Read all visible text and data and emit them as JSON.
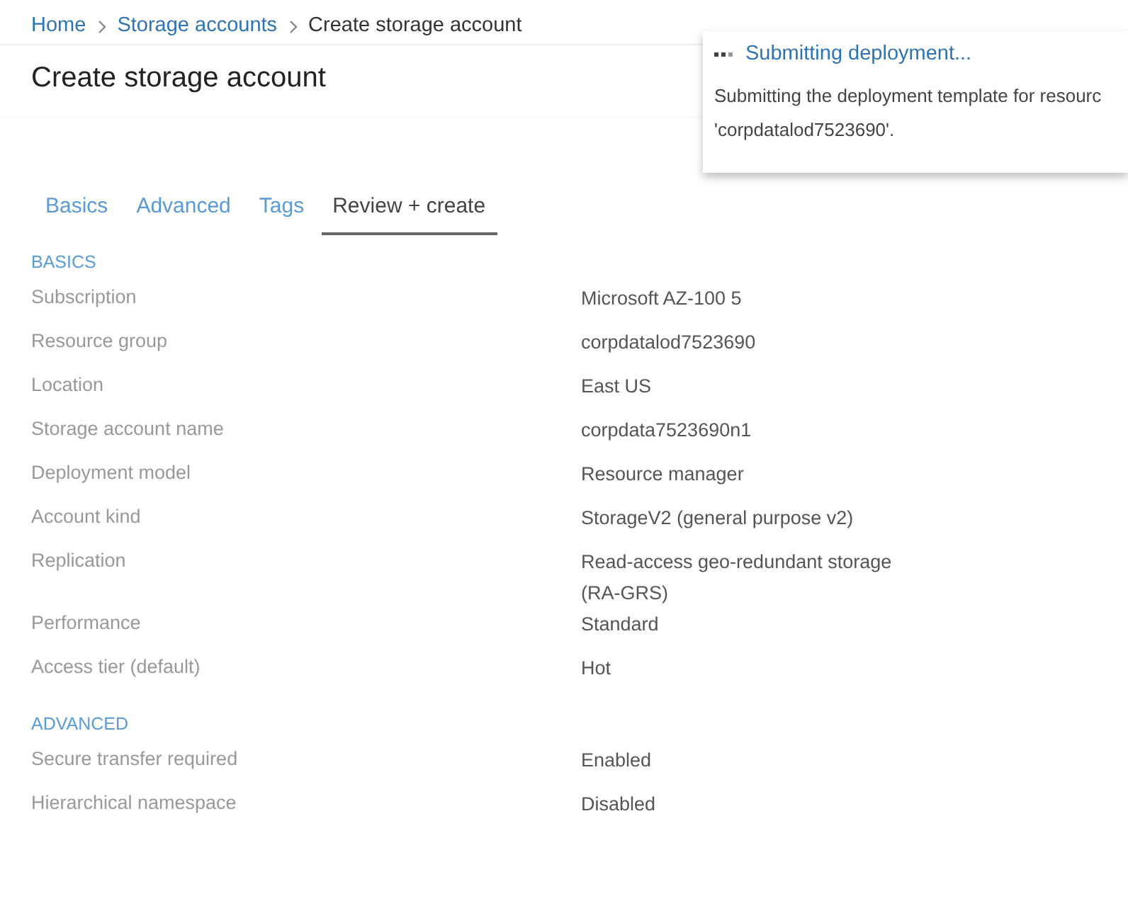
{
  "breadcrumb": [
    {
      "label": "Home",
      "kind": "link"
    },
    {
      "label": "Storage accounts",
      "kind": "link"
    },
    {
      "label": "Create storage account",
      "kind": "current"
    }
  ],
  "title": "Create storage account",
  "notification": {
    "title": "Submitting deployment...",
    "message": "Submitting the deployment template for resourc",
    "detail": "'corpdatalod7523690'."
  },
  "tabs": [
    {
      "label": "Basics",
      "selected": false
    },
    {
      "label": "Advanced",
      "selected": false
    },
    {
      "label": "Tags",
      "selected": false
    },
    {
      "label": "Review + create",
      "selected": true
    }
  ],
  "sections": [
    {
      "heading": "BASICS",
      "rows": [
        {
          "label": "Subscription",
          "value": "Microsoft AZ-100 5"
        },
        {
          "label": "Resource group",
          "value": "corpdatalod7523690"
        },
        {
          "label": "Location",
          "value": "East US"
        },
        {
          "label": "Storage account name",
          "value": "corpdata7523690n1"
        },
        {
          "label": "Deployment model",
          "value": "Resource manager"
        },
        {
          "label": "Account kind",
          "value": "StorageV2 (general purpose v2)"
        },
        {
          "label": "Replication",
          "value": "Read-access geo-redundant storage (RA-GRS)"
        },
        {
          "label": "Performance",
          "value": "Standard"
        },
        {
          "label": "Access tier (default)",
          "value": "Hot"
        }
      ]
    },
    {
      "heading": "ADVANCED",
      "rows": [
        {
          "label": "Secure transfer required",
          "value": "Enabled"
        },
        {
          "label": "Hierarchical namespace",
          "value": "Disabled"
        }
      ]
    }
  ]
}
